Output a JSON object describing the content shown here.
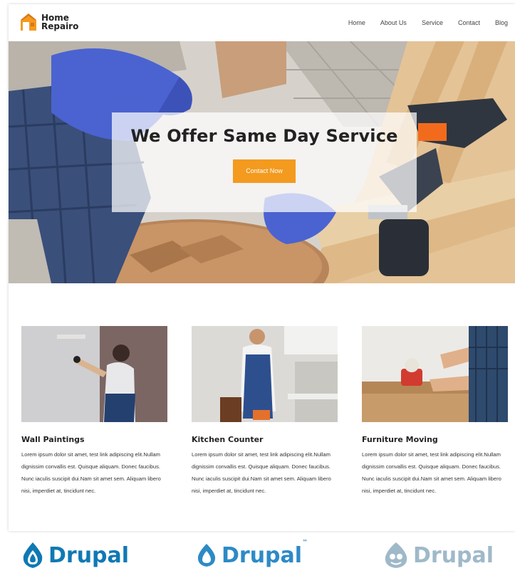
{
  "header": {
    "logo_text": "Home\nRepairo",
    "nav": [
      "Home",
      "About Us",
      "Service",
      "Contact",
      "Blog"
    ]
  },
  "hero": {
    "title": "We Offer Same Day Service",
    "button_label": "Contact Now"
  },
  "services": [
    {
      "title": "Wall Paintings",
      "text": "Lorem ipsum dolor sit amet, test link adipiscing elit.Nullam dignissim convallis est. Quisque aliquam. Donec faucibus. Nunc iaculis suscipit dui.Nam sit amet sem. Aliquam libero nisi, imperdiet at, tincidunt nec."
    },
    {
      "title": "Kitchen Counter",
      "text": "Lorem ipsum dolor sit amet, test link adipiscing elit.Nullam dignissim convallis est. Quisque aliquam. Donec faucibus. Nunc iaculis suscipit dui.Nam sit amet sem. Aliquam libero nisi, imperdiet at, tincidunt nec."
    },
    {
      "title": "Furniture Moving",
      "text": "Lorem ipsum dolor sit amet, test link adipiscing elit.Nullam dignissim convallis est. Quisque aliquam. Donec faucibus. Nunc iaculis suscipit dui.Nam sit amet sem. Aliquam libero nisi, imperdiet at, tincidunt nec."
    }
  ],
  "drupal_logos": [
    {
      "word": "Drupal",
      "color": "#0f79b4"
    },
    {
      "word": "Drupal",
      "tm": "™",
      "color": "#2d8ac6"
    },
    {
      "word": "Drupal",
      "color": "#9fb9c9"
    }
  ],
  "colors": {
    "accent": "#f39a1f",
    "logo_orange": "#f39a1f"
  }
}
